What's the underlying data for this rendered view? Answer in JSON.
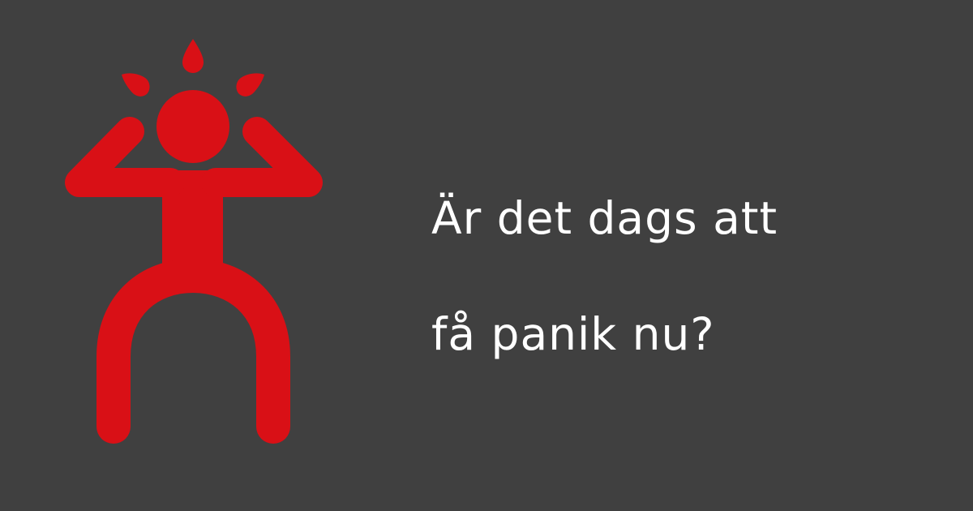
{
  "colors": {
    "background": "#404040",
    "figure": "#d91016",
    "text": "#ffffff"
  },
  "illustration": {
    "icon": "panicking-person-icon"
  },
  "headline": {
    "line1": "Är det dags att",
    "line2": "få panik nu?"
  }
}
